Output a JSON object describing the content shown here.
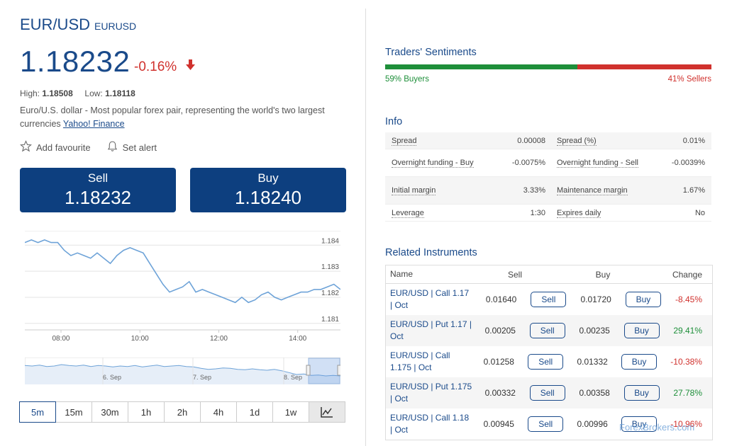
{
  "header": {
    "pair": "EUR/USD",
    "symbol": "EURUSD",
    "price": "1.18232",
    "change": "-0.16%"
  },
  "hilo": {
    "high_label": "High:",
    "high": "1.18508",
    "low_label": "Low:",
    "low": "1.18118"
  },
  "description": {
    "text": "Euro/U.S. dollar - Most popular forex pair, representing the world's two largest currencies",
    "link": "Yahoo! Finance"
  },
  "actions": {
    "favourite": "Add favourite",
    "alert": "Set alert"
  },
  "trade": {
    "sell_label": "Sell",
    "sell_price": "1.18232",
    "buy_label": "Buy",
    "buy_price": "1.18240"
  },
  "chart_data": {
    "type": "line",
    "x": [
      "07:05",
      "07:15",
      "07:25",
      "07:35",
      "07:45",
      "07:55",
      "08:05",
      "08:15",
      "08:25",
      "08:35",
      "08:45",
      "08:55",
      "09:05",
      "09:15",
      "09:25",
      "09:35",
      "09:45",
      "09:55",
      "10:05",
      "10:15",
      "10:25",
      "10:35",
      "10:45",
      "10:55",
      "11:05",
      "11:15",
      "11:25",
      "11:35",
      "11:45",
      "11:55",
      "12:05",
      "12:15",
      "12:25",
      "12:35",
      "12:45",
      "12:55",
      "13:05",
      "13:15",
      "13:25",
      "13:35",
      "13:45",
      "13:55",
      "14:05",
      "14:15",
      "14:25",
      "14:35",
      "14:45",
      "14:55",
      "15:05"
    ],
    "values": [
      1.1841,
      1.1842,
      1.1841,
      1.1842,
      1.1841,
      1.1841,
      1.1838,
      1.1836,
      1.1837,
      1.1836,
      1.1835,
      1.1837,
      1.1835,
      1.1833,
      1.1836,
      1.1838,
      1.1839,
      1.1838,
      1.1837,
      1.1833,
      1.1829,
      1.1825,
      1.1822,
      1.1823,
      1.1824,
      1.1826,
      1.1822,
      1.1823,
      1.1822,
      1.1821,
      1.182,
      1.1819,
      1.1818,
      1.182,
      1.1818,
      1.1819,
      1.1821,
      1.1822,
      1.182,
      1.1819,
      1.182,
      1.1821,
      1.1822,
      1.1822,
      1.1823,
      1.1823,
      1.1824,
      1.1825,
      1.1823
    ],
    "yticks": [
      "1.184",
      "1.183",
      "1.182",
      "1.181"
    ],
    "xticks": [
      "08:00",
      "10:00",
      "12:00",
      "14:00"
    ],
    "ylim": [
      1.18075,
      1.18455
    ]
  },
  "navigator": {
    "labels": [
      "6. Sep",
      "7. Sep",
      "8. Sep"
    ],
    "values": [
      1.1844,
      1.1843,
      1.1845,
      1.1842,
      1.1843,
      1.1846,
      1.1844,
      1.1843,
      1.1845,
      1.1842,
      1.1844,
      1.1843,
      1.1841,
      1.1843,
      1.1842,
      1.1844,
      1.1841,
      1.1843,
      1.1845,
      1.1842,
      1.1843,
      1.1844,
      1.1842,
      1.1841,
      1.1838,
      1.1836,
      1.1837,
      1.1839,
      1.1838,
      1.1836,
      1.1835,
      1.1837,
      1.1835,
      1.1834,
      1.1836,
      1.1833,
      1.1829,
      1.1825,
      1.1826,
      1.1823,
      1.1824,
      1.1822,
      1.1823,
      1.1822
    ]
  },
  "timeframes": [
    "5m",
    "15m",
    "30m",
    "1h",
    "2h",
    "4h",
    "1d",
    "1w"
  ],
  "sentiment": {
    "title": "Traders' Sentiments",
    "buyers": "59% Buyers",
    "sellers": "41% Sellers",
    "buyers_pct": 59,
    "colors": {
      "buy": "#1e8f3a",
      "sell": "#d0312d"
    }
  },
  "info": {
    "title": "Info",
    "rows": [
      {
        "k1": "Spread",
        "v1": "0.00008",
        "k2": "Spread (%)",
        "v2": "0.01%"
      },
      {
        "k1": "Overnight funding - Buy",
        "v1": "-0.0075%",
        "k2": "Overnight funding - Sell",
        "v2": "-0.0039%"
      },
      {
        "k1": "Initial margin",
        "v1": "3.33%",
        "k2": "Maintenance margin",
        "v2": "1.67%"
      },
      {
        "k1": "Leverage",
        "v1": "1:30",
        "k2": "Expires daily",
        "v2": "No"
      }
    ]
  },
  "related": {
    "title": "Related Instruments",
    "headers": {
      "name": "Name",
      "sell": "Sell",
      "buy": "Buy",
      "change": "Change"
    },
    "sell_btn": "Sell",
    "buy_btn": "Buy",
    "rows": [
      {
        "name": "EUR/USD | Call 1.17 | Oct",
        "sell": "0.01640",
        "buy": "0.01720",
        "change": "-8.45%"
      },
      {
        "name": "EUR/USD | Put 1.17 | Oct",
        "sell": "0.00205",
        "buy": "0.00235",
        "change": "29.41%"
      },
      {
        "name": "EUR/USD | Call 1.175 | Oct",
        "sell": "0.01258",
        "buy": "0.01332",
        "change": "-10.38%"
      },
      {
        "name": "EUR/USD | Put 1.175 | Oct",
        "sell": "0.00332",
        "buy": "0.00358",
        "change": "27.78%"
      },
      {
        "name": "EUR/USD | Call 1.18 | Oct",
        "sell": "0.00945",
        "buy": "0.00996",
        "change": "-10.96%"
      }
    ]
  },
  "watermark": "ForexBrokers.com"
}
